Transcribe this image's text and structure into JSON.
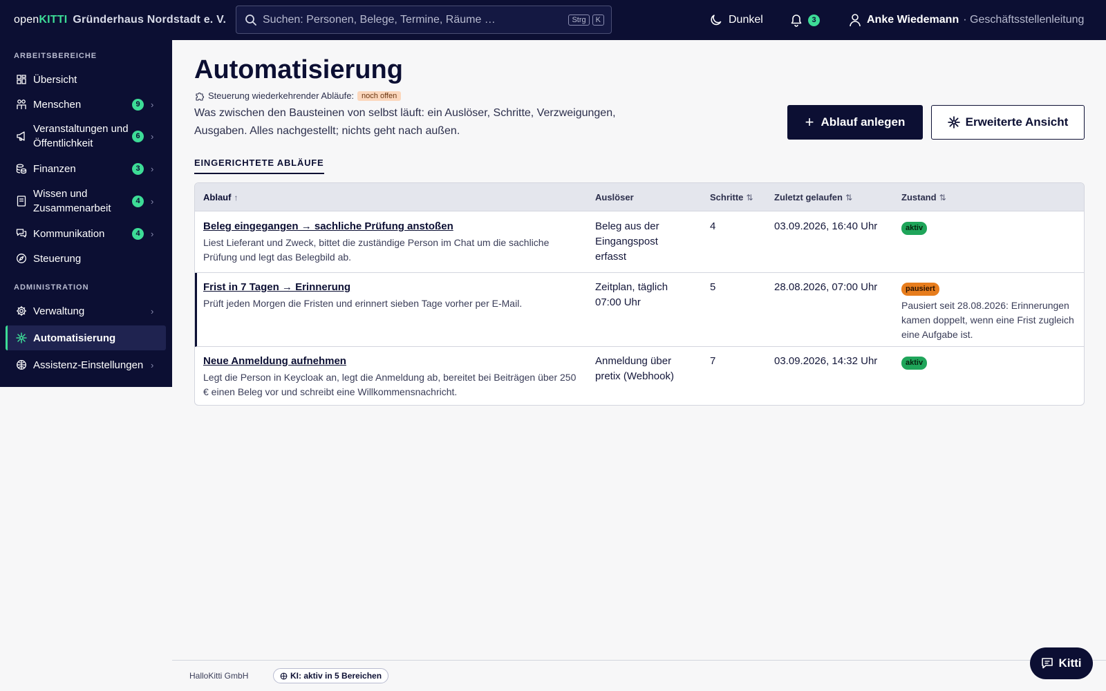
{
  "header": {
    "brand_open": "open",
    "brand_kitti": "KITTI",
    "org_name": "Gründerhaus Nordstadt e. V.",
    "search_placeholder": "Suchen: Personen, Belege, Termine, Räume …",
    "search_kbd_1": "Strg",
    "search_kbd_2": "K",
    "dark_label": "Dunkel",
    "notification_count": "3",
    "user_name": "Anke Wiedemann",
    "user_role": "· Geschäftsstellenleitung"
  },
  "sidebar": {
    "section_work": "ARBEITSBEREICHE",
    "section_admin": "ADMINISTRATION",
    "items": [
      {
        "label": "Übersicht",
        "icon": "grid-icon"
      },
      {
        "label": "Menschen",
        "count": "9",
        "icon": "people-icon"
      },
      {
        "label": "Veranstaltungen und Öffentlichkeit",
        "count": "6",
        "icon": "megaphone-icon"
      },
      {
        "label": "Finanzen",
        "count": "3",
        "icon": "coins-icon"
      },
      {
        "label": "Wissen und Zusammenarbeit",
        "count": "4",
        "icon": "book-icon"
      },
      {
        "label": "Kommunikation",
        "count": "4",
        "icon": "chat-icon"
      },
      {
        "label": "Steuerung",
        "icon": "compass-icon"
      },
      {
        "label": "Verwaltung",
        "icon": "gear-icon"
      },
      {
        "label": "Automatisierung",
        "icon": "automation-icon"
      },
      {
        "label": "Assistenz-Einstellungen",
        "icon": "assistant-icon"
      }
    ],
    "accent_color": "#3ddc97"
  },
  "main": {
    "title": "Automatisierung",
    "subline_label": "Steuerung wiederkehrender Abläufe:",
    "subline_badge": "noch offen",
    "description": "Was zwischen den Bausteinen von selbst läuft: ein Auslöser, Schritte, Verzweigungen, Ausgaben. Alles nachgestellt; nichts geht nach außen.",
    "btn_add": "Ablauf anlegen",
    "btn_advanced": "Erweiterte Ansicht",
    "tab_label": "EINGERICHTETE ABLÄUFE"
  },
  "table": {
    "headers": {
      "flow": "Ablauf",
      "flow_sort": "↑",
      "trigger": "Auslöser",
      "steps": "Schritte",
      "steps_sort": "⇅",
      "last_run": "Zuletzt gelaufen",
      "last_run_sort": "⇅",
      "state": "Zustand",
      "state_sort": "⇅"
    },
    "rows": [
      {
        "title": "Beleg eingegangen → sachliche Prüfung anstoßen",
        "desc": "Liest Lieferant und Zweck, bittet die zuständige Person im Chat um die sachliche Prüfung und legt das Belegbild ab.",
        "trigger": "Beleg aus der Eingangspost erfasst",
        "steps": "4",
        "last_run": "03.09.2026, 16:40 Uhr",
        "state": "aktiv",
        "note": ""
      },
      {
        "title": "Frist in 7 Tagen → Erinnerung",
        "desc": "Prüft jeden Morgen die Fristen und erinnert sieben Tage vorher per E-Mail.",
        "trigger": "Zeitplan, täglich 07:00 Uhr",
        "steps": "5",
        "last_run": "28.08.2026, 07:00 Uhr",
        "state": "pausiert",
        "note": "Pausiert seit 28.08.2026: Erinnerungen kamen doppelt, wenn eine Frist zugleich eine Aufgabe ist."
      },
      {
        "title": "Neue Anmeldung aufnehmen",
        "desc": "Legt die Person in Keycloak an, legt die Anmeldung ab, bereitet bei Beiträgen über 250 € einen Beleg vor und schreibt eine Willkommensnachricht.",
        "trigger": "Anmeldung über pretix (Webhook)",
        "steps": "7",
        "last_run": "03.09.2026, 14:32 Uhr",
        "state": "aktiv",
        "note": ""
      }
    ]
  },
  "footer": {
    "company": "HalloKitti GmbH",
    "ki_status": "KI: aktiv in 5 Bereichen",
    "chat_button": "Kitti"
  }
}
